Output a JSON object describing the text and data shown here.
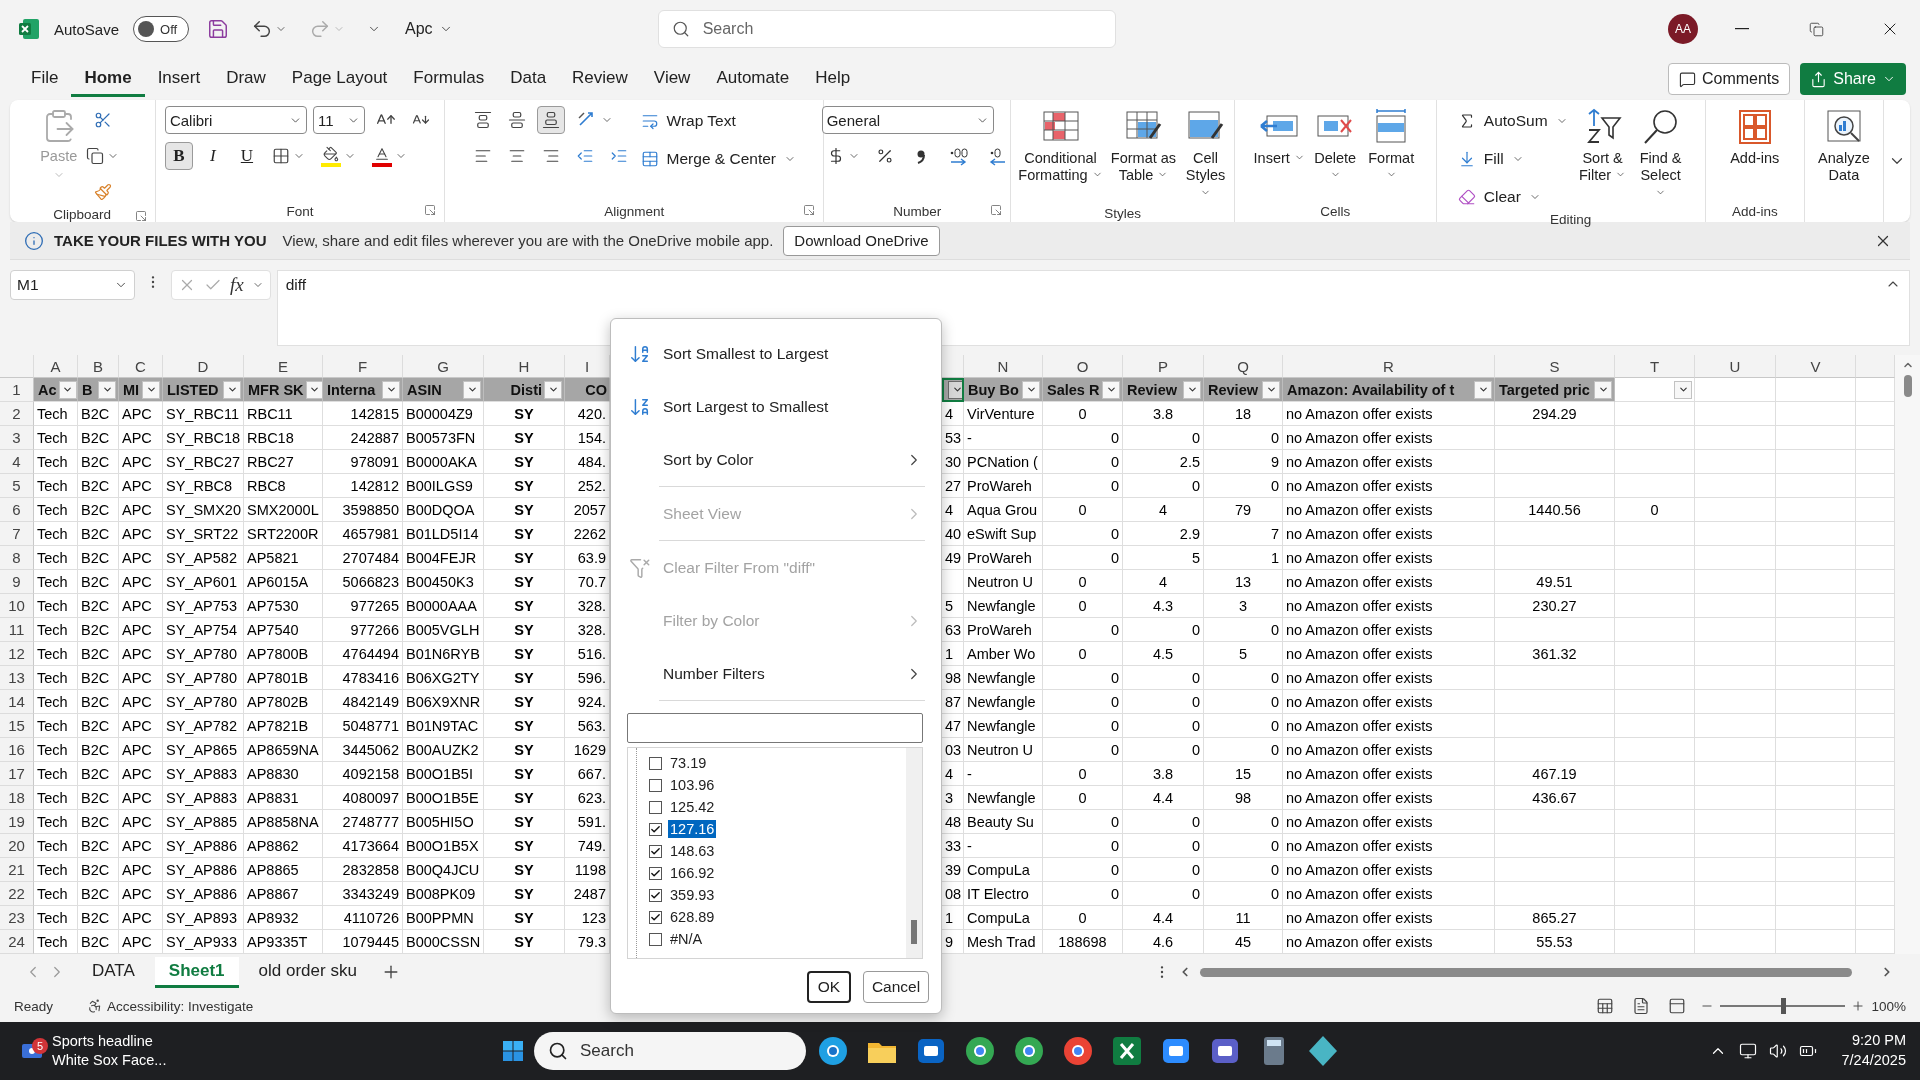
{
  "title_bar": {
    "autosave_label": "AutoSave",
    "autosave_state": "Off",
    "autosave_on": false,
    "file_name": "Apc",
    "placeholder": "Search",
    "avatar": "AA"
  },
  "menu_tabs": [
    {
      "label": "File",
      "selected": false
    },
    {
      "label": "Home",
      "selected": true
    },
    {
      "label": "Insert",
      "selected": false
    },
    {
      "label": "Draw",
      "selected": false
    },
    {
      "label": "Page Layout",
      "selected": false
    },
    {
      "label": "Formulas",
      "selected": false
    },
    {
      "label": "Data",
      "selected": false
    },
    {
      "label": "Review",
      "selected": false
    },
    {
      "label": "View",
      "selected": false
    },
    {
      "label": "Automate",
      "selected": false
    },
    {
      "label": "Help",
      "selected": false
    }
  ],
  "header_buttons": {
    "comments": "Comments",
    "share": "Share"
  },
  "ribbon": {
    "clipboard": {
      "group": "Clipboard",
      "paste": "Paste"
    },
    "font": {
      "group": "Font",
      "face": "Calibri",
      "size": "11",
      "styles": [
        {
          "label": "B",
          "pressed": true
        },
        {
          "label": "I",
          "pressed": false
        },
        {
          "label": "U",
          "pressed": false
        }
      ]
    },
    "alignment": {
      "group": "Alignment",
      "vertical": [
        {
          "pressed": false
        },
        {
          "pressed": false
        },
        {
          "pressed": true
        }
      ],
      "wrap": "Wrap Text",
      "merge": "Merge & Center"
    },
    "number": {
      "group": "Number",
      "format": "General"
    },
    "styles": {
      "group": "Styles",
      "buttons": [
        "Conditional Formatting",
        "Format as Table",
        "Cell Styles"
      ]
    },
    "cells": {
      "group": "Cells",
      "buttons": [
        "Insert",
        "Delete",
        "Format"
      ]
    },
    "editing": {
      "group": "Editing",
      "small": [
        "AutoSum",
        "Fill",
        "Clear"
      ],
      "large": [
        "Sort & Filter",
        "Find & Select"
      ]
    },
    "addins": {
      "group": "Add-ins",
      "buttons": [
        "Add-ins"
      ]
    },
    "analyze": {
      "buttons": [
        "Analyze Data"
      ]
    }
  },
  "info_bar": {
    "title": "TAKE YOUR FILES WITH YOU",
    "message": "View, share and edit files wherever you are with the OneDrive mobile app.",
    "button": "Download OneDrive"
  },
  "formula_bar": {
    "name_box": "M1",
    "fx": "fx",
    "formula": "diff"
  },
  "column_letters": [
    "A",
    "B",
    "C",
    "D",
    "E",
    "F",
    "G",
    "H",
    "I",
    "N",
    "O",
    "P",
    "Q",
    "R",
    "S",
    "T",
    "U",
    "V"
  ],
  "header_row": {
    "number": "1",
    "cells": [
      {
        "text": "Ac",
        "shaded": true,
        "selected": false,
        "filter": true
      },
      {
        "text": "B",
        "shaded": true,
        "selected": false,
        "filter": true
      },
      {
        "text": "MI",
        "shaded": true,
        "selected": false,
        "filter": true
      },
      {
        "text": "LISTED",
        "shaded": true,
        "selected": false,
        "filter": true
      },
      {
        "text": "MFR SK",
        "shaded": true,
        "selected": false,
        "filter": true
      },
      {
        "text": "Interna",
        "shaded": true,
        "selected": false,
        "filter": true
      },
      {
        "text": "ASIN",
        "shaded": true,
        "selected": false,
        "filter": true
      },
      {
        "text": "Disti",
        "shaded": true,
        "selected": false,
        "filter": true
      },
      {
        "text": "CO",
        "shaded": true,
        "selected": false,
        "filter": false
      },
      {
        "shaded": true,
        "selected": true,
        "filter": true
      },
      {
        "text": "Buy Bo",
        "shaded": true,
        "selected": false,
        "filter": true
      },
      {
        "text": "Sales R",
        "shaded": true,
        "selected": false,
        "filter": true
      },
      {
        "text": "Review",
        "shaded": true,
        "selected": false,
        "filter": true
      },
      {
        "text": "Review",
        "shaded": true,
        "selected": false,
        "filter": true
      },
      {
        "text": "Amazon: Availability of t",
        "shaded": true,
        "selected": false,
        "filter": true
      },
      {
        "text": "Targeted pric",
        "shaded": true,
        "selected": false,
        "filter": true
      },
      {
        "shaded": false,
        "selected": false,
        "filter": true
      }
    ]
  },
  "rows": [
    {
      "number": "2",
      "numbers_as_text": true,
      "cells": [
        "Tech",
        "B2C",
        "APC",
        "SY_RBC11",
        "RBC11",
        "142815",
        "B00004Z9",
        "SY",
        "420.",
        "4",
        "VirVenture",
        "0",
        "3.8",
        "18",
        "no Amazon offer exists",
        "294.29",
        null
      ]
    },
    {
      "number": "3",
      "numbers_as_text": false,
      "cells": [
        "Tech",
        "B2C",
        "APC",
        "SY_RBC18",
        "RBC18",
        "242887",
        "B00573FN",
        "SY",
        "154.",
        "53",
        "-",
        "0",
        "0",
        "0",
        "no Amazon offer exists",
        null,
        null
      ]
    },
    {
      "number": "4",
      "numbers_as_text": false,
      "cells": [
        "Tech",
        "B2C",
        "APC",
        "SY_RBC27",
        "RBC27",
        "978091",
        "B0000AKA",
        "SY",
        "484.",
        "30",
        "PCNation (",
        "0",
        "2.5",
        "9",
        "no Amazon offer exists",
        null,
        null
      ]
    },
    {
      "number": "5",
      "numbers_as_text": false,
      "cells": [
        "Tech",
        "B2C",
        "APC",
        "SY_RBC8",
        "RBC8",
        "142812",
        "B00ILGS9",
        "SY",
        "252.",
        "27",
        "ProWareh",
        "0",
        "0",
        "0",
        "no Amazon offer exists",
        null,
        null
      ]
    },
    {
      "number": "6",
      "numbers_as_text": true,
      "cells": [
        "Tech",
        "B2C",
        "APC",
        "SY_SMX20",
        "SMX2000L",
        "3598850",
        "B00DQOA",
        "SY",
        "2057",
        "4",
        "Aqua Grou",
        "0",
        "4",
        "79",
        "no Amazon offer exists",
        "1440.56",
        "0"
      ]
    },
    {
      "number": "7",
      "numbers_as_text": false,
      "cells": [
        "Tech",
        "B2C",
        "APC",
        "SY_SRT22",
        "SRT2200R",
        "4657981",
        "B01LD5I14",
        "SY",
        "2262",
        "40",
        "eSwift Sup",
        "0",
        "2.9",
        "7",
        "no Amazon offer exists",
        null,
        null
      ]
    },
    {
      "number": "8",
      "numbers_as_text": false,
      "cells": [
        "Tech",
        "B2C",
        "APC",
        "SY_AP582",
        "AP5821",
        "2707484",
        "B004FEJR",
        "SY",
        "63.9",
        "49",
        "ProWareh",
        "0",
        "5",
        "1",
        "no Amazon offer exists",
        null,
        null
      ]
    },
    {
      "number": "9",
      "numbers_as_text": true,
      "cells": [
        "Tech",
        "B2C",
        "APC",
        "SY_AP601",
        "AP6015A",
        "5066823",
        "B00450K3",
        "SY",
        "70.7",
        null,
        "Neutron U",
        "0",
        "4",
        "13",
        "no Amazon offer exists",
        "49.51",
        null
      ]
    },
    {
      "number": "10",
      "numbers_as_text": true,
      "cells": [
        "Tech",
        "B2C",
        "APC",
        "SY_AP753",
        "AP7530",
        "977265",
        "B0000AAA",
        "SY",
        "328.",
        "5",
        "Newfangle",
        "0",
        "4.3",
        "3",
        "no Amazon offer exists",
        "230.27",
        null
      ]
    },
    {
      "number": "11",
      "numbers_as_text": false,
      "cells": [
        "Tech",
        "B2C",
        "APC",
        "SY_AP754",
        "AP7540",
        "977266",
        "B005VGLH",
        "SY",
        "328.",
        "63",
        "ProWareh",
        "0",
        "0",
        "0",
        "no Amazon offer exists",
        null,
        null
      ]
    },
    {
      "number": "12",
      "numbers_as_text": true,
      "cells": [
        "Tech",
        "B2C",
        "APC",
        "SY_AP780",
        "AP7800B",
        "4764494",
        "B01N6RYB",
        "SY",
        "516.",
        "1",
        "Amber Wo",
        "0",
        "4.5",
        "5",
        "no Amazon offer exists",
        "361.32",
        null
      ]
    },
    {
      "number": "13",
      "numbers_as_text": false,
      "cells": [
        "Tech",
        "B2C",
        "APC",
        "SY_AP780",
        "AP7801B",
        "4783416",
        "B06XG2TY",
        "SY",
        "596.",
        "98",
        "Newfangle",
        "0",
        "0",
        "0",
        "no Amazon offer exists",
        null,
        null
      ]
    },
    {
      "number": "14",
      "numbers_as_text": false,
      "cells": [
        "Tech",
        "B2C",
        "APC",
        "SY_AP780",
        "AP7802B",
        "4842149",
        "B06X9XNR",
        "SY",
        "924.",
        "87",
        "Newfangle",
        "0",
        "0",
        "0",
        "no Amazon offer exists",
        null,
        null
      ]
    },
    {
      "number": "15",
      "numbers_as_text": false,
      "cells": [
        "Tech",
        "B2C",
        "APC",
        "SY_AP782",
        "AP7821B",
        "5048771",
        "B01N9TAC",
        "SY",
        "563.",
        "47",
        "Newfangle",
        "0",
        "0",
        "0",
        "no Amazon offer exists",
        null,
        null
      ]
    },
    {
      "number": "16",
      "numbers_as_text": false,
      "cells": [
        "Tech",
        "B2C",
        "APC",
        "SY_AP865",
        "AP8659NA",
        "3445062",
        "B00AUZK2",
        "SY",
        "1629",
        "03",
        "Neutron U",
        "0",
        "0",
        "0",
        "no Amazon offer exists",
        null,
        null
      ]
    },
    {
      "number": "17",
      "numbers_as_text": true,
      "cells": [
        "Tech",
        "B2C",
        "APC",
        "SY_AP883",
        "AP8830",
        "4092158",
        "B00O1B5I",
        "SY",
        "667.",
        "4",
        "-",
        "0",
        "3.8",
        "15",
        "no Amazon offer exists",
        "467.19",
        null
      ]
    },
    {
      "number": "18",
      "numbers_as_text": true,
      "cells": [
        "Tech",
        "B2C",
        "APC",
        "SY_AP883",
        "AP8831",
        "4080097",
        "B00O1B5E",
        "SY",
        "623.",
        "3",
        "Newfangle",
        "0",
        "4.4",
        "98",
        "no Amazon offer exists",
        "436.67",
        null
      ]
    },
    {
      "number": "19",
      "numbers_as_text": false,
      "cells": [
        "Tech",
        "B2C",
        "APC",
        "SY_AP885",
        "AP8858NA",
        "2748777",
        "B005HI5O",
        "SY",
        "591.",
        "48",
        "Beauty Su",
        "0",
        "0",
        "0",
        "no Amazon offer exists",
        null,
        null
      ]
    },
    {
      "number": "20",
      "numbers_as_text": false,
      "cells": [
        "Tech",
        "B2C",
        "APC",
        "SY_AP886",
        "AP8862",
        "4173664",
        "B00O1B5X",
        "SY",
        "749.",
        "33",
        "-",
        "0",
        "0",
        "0",
        "no Amazon offer exists",
        null,
        null
      ]
    },
    {
      "number": "21",
      "numbers_as_text": false,
      "cells": [
        "Tech",
        "B2C",
        "APC",
        "SY_AP886",
        "AP8865",
        "2832858",
        "B00Q4JCU",
        "SY",
        "1198",
        "39",
        "CompuLa",
        "0",
        "0",
        "0",
        "no Amazon offer exists",
        null,
        null
      ]
    },
    {
      "number": "22",
      "numbers_as_text": false,
      "cells": [
        "Tech",
        "B2C",
        "APC",
        "SY_AP886",
        "AP8867",
        "3343249",
        "B008PK09",
        "SY",
        "2487",
        "08",
        "IT Electro",
        "0",
        "0",
        "0",
        "no Amazon offer exists",
        null,
        null
      ]
    },
    {
      "number": "23",
      "numbers_as_text": true,
      "cells": [
        "Tech",
        "B2C",
        "APC",
        "SY_AP893",
        "AP8932",
        "4110726",
        "B00PPMN",
        "SY",
        "123",
        "1",
        "CompuLa",
        "0",
        "4.4",
        "11",
        "no Amazon offer exists",
        "865.27",
        null
      ]
    },
    {
      "number": "24",
      "numbers_as_text": true,
      "cells": [
        "Tech",
        "B2C",
        "APC",
        "SY_AP933",
        "AP9335T",
        "1079445",
        "B000CSSN",
        "SY",
        "79.3",
        "9",
        "Mesh Trad",
        "188698",
        "4.6",
        "45",
        "no Amazon offer exists",
        "55.53",
        null
      ]
    }
  ],
  "filter_menu": {
    "items": [
      {
        "label": "Sort Smallest to Largest",
        "kind": "sort_ascending",
        "disabled": false,
        "divider_after": false
      },
      {
        "label": "Sort Largest to Smallest",
        "kind": "sort_descending",
        "disabled": false,
        "divider_after": false
      },
      {
        "label": "Sort by Color",
        "kind": "submenu",
        "disabled": false,
        "divider_after": true
      },
      {
        "label": "Sheet View",
        "kind": "submenu",
        "disabled": true,
        "divider_after": true
      },
      {
        "label": "Clear Filter From \"diff\"",
        "kind": "clear_filter",
        "disabled": true,
        "divider_after": false
      },
      {
        "label": "Filter by Color",
        "kind": "submenu",
        "disabled": true,
        "divider_after": false
      },
      {
        "label": "Number Filters",
        "kind": "submenu",
        "disabled": false,
        "divider_after": true
      }
    ],
    "values": [
      {
        "label": "73.19",
        "checked": false,
        "selected": false
      },
      {
        "label": "103.96",
        "checked": false,
        "selected": false
      },
      {
        "label": "125.42",
        "checked": false,
        "selected": false
      },
      {
        "label": "127.16",
        "checked": true,
        "selected": true
      },
      {
        "label": "148.63",
        "checked": true,
        "selected": false
      },
      {
        "label": "166.92",
        "checked": true,
        "selected": false
      },
      {
        "label": "359.93",
        "checked": true,
        "selected": false
      },
      {
        "label": "628.89",
        "checked": true,
        "selected": false
      },
      {
        "label": "#N/A",
        "checked": false,
        "selected": false
      }
    ],
    "buttons": [
      "OK",
      "Cancel"
    ]
  },
  "sheet_tabs": [
    {
      "label": "DATA",
      "selected": false
    },
    {
      "label": "Sheet1",
      "selected": true
    },
    {
      "label": "old order sku",
      "selected": false
    }
  ],
  "status_bar": {
    "mode": "Ready",
    "accessibility": "Accessibility: Investigate",
    "zoom": "100%",
    "zoom_slider": {
      "level": 0.5
    }
  },
  "taskbar": {
    "widget_badge": "5",
    "widget_title": "Sports headline",
    "widget_subtitle": "White Sox Face...",
    "search_label": "Search",
    "time": "9:20 PM",
    "date": "7/24/2025"
  }
}
